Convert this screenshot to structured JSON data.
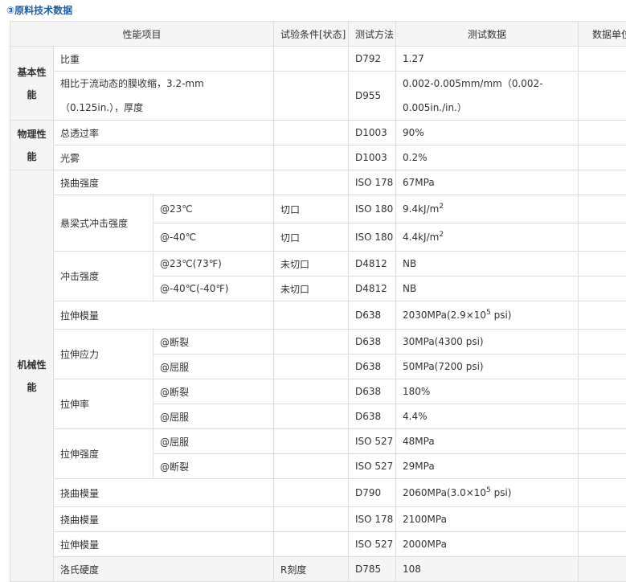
{
  "section_title": "③原料技术数据",
  "headers": [
    "性能项目",
    "试验条件[状态]",
    "测试方法",
    "测试数据",
    "数据单位"
  ],
  "basic": {
    "category": "基本性能",
    "rows": [
      {
        "item": "比重",
        "method": "D792",
        "value": "1.27"
      },
      {
        "item": "相比于流动态的膜收缩，3.2-mm（0.125in.），厚度",
        "method": "D955",
        "value": "0.002-0.005mm/mm（0.002-0.005in./in.）"
      }
    ]
  },
  "physical": {
    "category": "物理性能",
    "rows": [
      {
        "item": "总透过率",
        "method": "D1003",
        "value": "90%"
      },
      {
        "item": "光雾",
        "method": "D1003",
        "value": "0.2%"
      }
    ]
  },
  "mechanical": {
    "category": "机械性能",
    "flex_strength": {
      "item": "挠曲强度",
      "method": "ISO 178",
      "value": "67MPa"
    },
    "izod": {
      "item": "悬梁式冲击强度",
      "rows": [
        {
          "sub": "@23℃",
          "condition": "切口",
          "method": "ISO 180",
          "value": "9.4kJ/m",
          "sup": "2"
        },
        {
          "sub": "@-40℃",
          "condition": "切口",
          "method": "ISO 180",
          "value": "4.4kJ/m",
          "sup": "2"
        }
      ]
    },
    "impact": {
      "item": "冲击强度",
      "rows": [
        {
          "sub": "@23℃(73℉)",
          "condition": "未切口",
          "method": "D4812",
          "value": "NB"
        },
        {
          "sub": "@-40℃(-40℉)",
          "condition": "未切口",
          "method": "D4812",
          "value": "NB"
        }
      ]
    },
    "tensile_modulus": {
      "item": "拉伸模量",
      "method": "D638",
      "value_pre": "2030MPa(2.9×10",
      "sup": "5",
      "value_post": " psi)"
    },
    "tensile_stress": {
      "item": "拉伸应力",
      "rows": [
        {
          "sub": "@断裂",
          "method": "D638",
          "value": "30MPa(4300 psi)"
        },
        {
          "sub": "@屈服",
          "method": "D638",
          "value": "50MPa(7200 psi)"
        }
      ]
    },
    "elongation": {
      "item": "拉伸率",
      "rows": [
        {
          "sub": "@断裂",
          "method": "D638",
          "value": "180%"
        },
        {
          "sub": "@屈服",
          "method": "D638",
          "value": "4.4%"
        }
      ]
    },
    "tensile_strength": {
      "item": "拉伸强度",
      "rows": [
        {
          "sub": "@屈服",
          "method": "ISO 527",
          "value": "48MPa"
        },
        {
          "sub": "@断裂",
          "method": "ISO 527",
          "value": "29MPa"
        }
      ]
    },
    "flex_modulus_1": {
      "item": "挠曲模量",
      "method": "D790",
      "value_pre": "2060MPa(3.0×10",
      "sup": "5",
      "value_post": " psi)"
    },
    "flex_modulus_2": {
      "item": "挠曲模量",
      "method": "ISO 178",
      "value": "2100MPa"
    },
    "flex_modulus_3": {
      "item": "拉伸模量",
      "method": "ISO 527",
      "value": "2000MPa"
    },
    "hardness": {
      "item": "洛氏硬度",
      "condition": "R刻度",
      "method": "D785",
      "value": "108"
    }
  }
}
